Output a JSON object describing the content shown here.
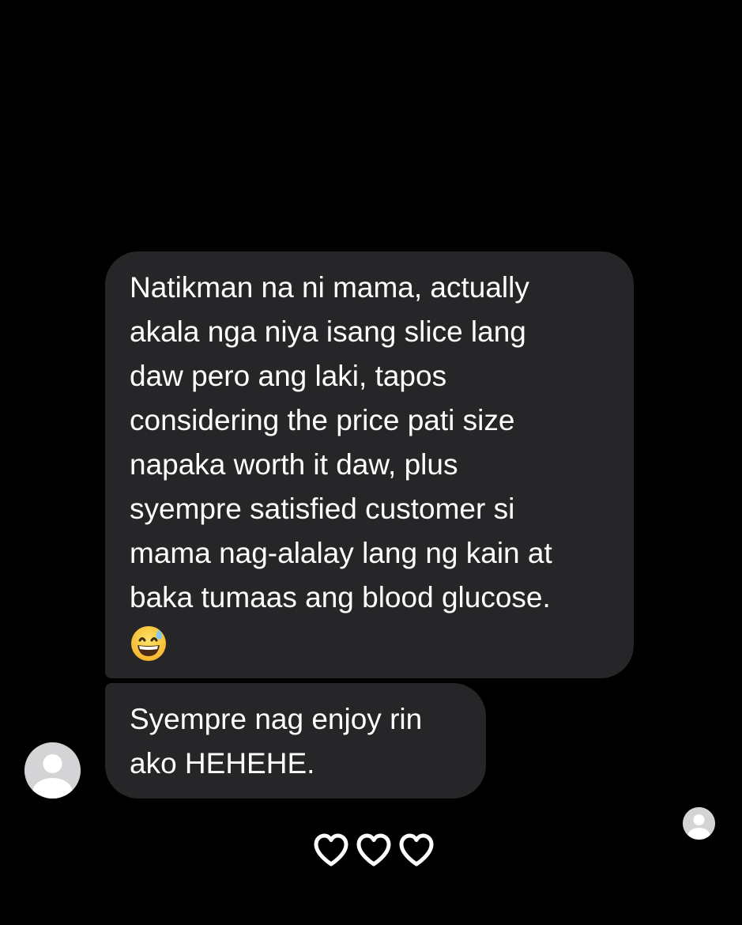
{
  "conversation": {
    "messages": [
      {
        "lines": [
          "Natikman na ni mama, actually",
          "akala nga niya isang slice lang",
          "daw pero ang laki, tapos",
          "considering the price pati size",
          "napaka worth it daw, plus",
          "syempre satisfied customer si",
          "mama nag-alalay lang ng kain at",
          "baka tumaas ang blood glucose."
        ],
        "emoji": "grinning-face-with-sweat"
      },
      {
        "lines": [
          "Syempre nag enjoy rin",
          "ako HEHEHE."
        ]
      }
    ],
    "sender_avatar": "default-person-icon",
    "seen_avatar": "default-person-icon",
    "reactions": [
      "heart-outline-icon",
      "heart-outline-icon",
      "heart-outline-icon"
    ]
  },
  "colors": {
    "background": "#000000",
    "bubble": "#262628",
    "text": "#ffffff",
    "avatar": "#d4d4d6"
  }
}
